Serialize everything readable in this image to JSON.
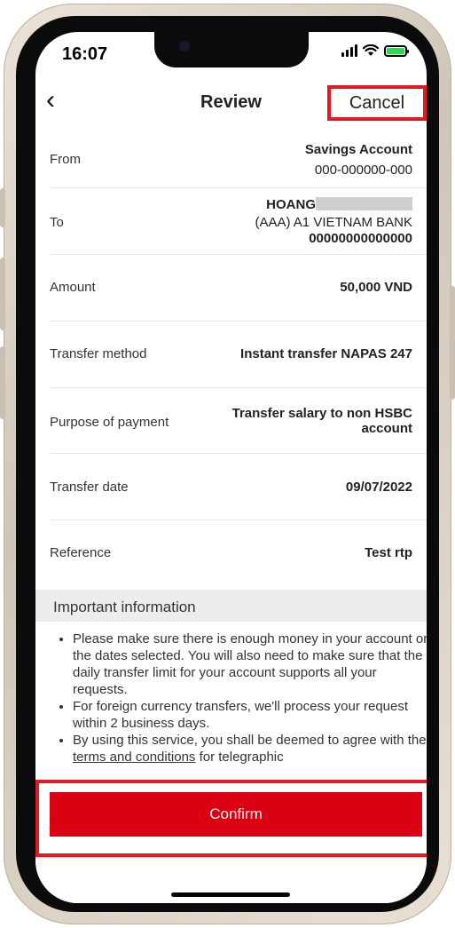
{
  "status": {
    "time": "16:07"
  },
  "nav": {
    "back_icon": "chevron-left-icon",
    "title": "Review",
    "cancel_label": "Cancel"
  },
  "rows": {
    "from": {
      "label": "From",
      "account_type": "Savings Account",
      "account_number": "000-000000-000"
    },
    "to": {
      "label": "To",
      "name": "HOANG",
      "bank": "(AAA) A1 VIETNAM BANK",
      "account_number": "00000000000000"
    },
    "amount": {
      "label": "Amount",
      "value": "50,000 VND"
    },
    "method": {
      "label": "Transfer method",
      "value": "Instant transfer NAPAS 247"
    },
    "purpose": {
      "label": "Purpose of payment",
      "value": "Transfer salary to non HSBC account"
    },
    "date": {
      "label": "Transfer date",
      "value": "09/07/2022"
    },
    "reference": {
      "label": "Reference",
      "value": "Test rtp"
    }
  },
  "important": {
    "title": "Important information",
    "items": [
      "Please make sure there is enough money in your account on the dates selected. You will also need to make sure that the daily transfer limit for your account supports all your requests.",
      "For foreign currency transfers, we'll process your request within 2 business days."
    ],
    "item3_prefix": "By using this service, you shall be deemed to agree with the ",
    "item3_link": "terms and conditions",
    "item3_suffix": " for telegraphic"
  },
  "footer": {
    "confirm_label": "Confirm"
  },
  "colors": {
    "accent": "#db0011",
    "highlight": "#e21a24"
  }
}
